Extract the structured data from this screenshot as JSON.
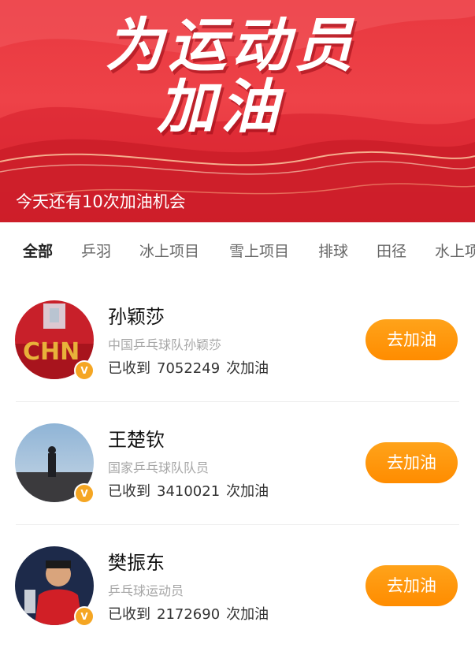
{
  "banner": {
    "title_line1": "为运动员",
    "title_line2": "加油",
    "subtitle": "今天还有10次加油机会",
    "bg_color": "#e8383f"
  },
  "tabs": [
    {
      "label": "全部",
      "active": true
    },
    {
      "label": "乒羽",
      "active": false
    },
    {
      "label": "冰上项目",
      "active": false
    },
    {
      "label": "雪上项目",
      "active": false
    },
    {
      "label": "排球",
      "active": false
    },
    {
      "label": "田径",
      "active": false
    },
    {
      "label": "水上项",
      "active": false
    }
  ],
  "athletes": [
    {
      "name": "孙颖莎",
      "desc": "中国乒乓球队孙颖莎",
      "received": "已收到",
      "count": "7052249",
      "unit": "次加油",
      "button": "去加油"
    },
    {
      "name": "王楚钦",
      "desc": "国家乒乓球队队员",
      "received": "已收到",
      "count": "3410021",
      "unit": "次加油",
      "button": "去加油"
    },
    {
      "name": "樊振东",
      "desc": "乒乓球运动员",
      "received": "已收到",
      "count": "2172690",
      "unit": "次加油",
      "button": "去加油"
    }
  ],
  "colors": {
    "accent": "#ff9500",
    "badge": "#f5a623"
  }
}
